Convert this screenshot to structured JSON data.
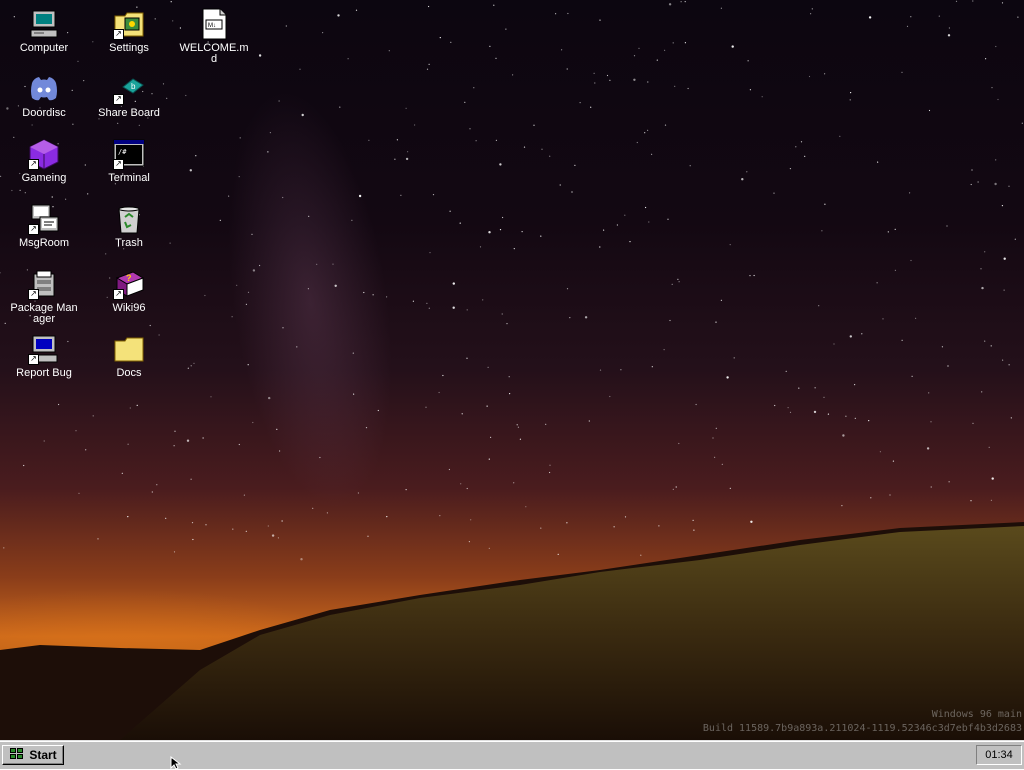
{
  "desktop": {
    "icons": [
      {
        "label": "Computer"
      },
      {
        "label": "Settings"
      },
      {
        "label": "WELCOME.md"
      },
      {
        "label": "Doordisc"
      },
      {
        "label": "Share Board"
      },
      {
        "label": "Gameing"
      },
      {
        "label": "Terminal"
      },
      {
        "label": "MsgRoom"
      },
      {
        "label": "Trash"
      },
      {
        "label": "Package Manager"
      },
      {
        "label": "Wiki96"
      },
      {
        "label": "Report Bug"
      },
      {
        "label": "Docs"
      }
    ],
    "watermark": {
      "line1": "Windows 96 main",
      "line2": "Build 11589.7b9a893a.211024-1119.52346c3d7ebf4b3d2683"
    }
  },
  "taskbar": {
    "start_label": "Start",
    "clock": "01:34"
  },
  "colors": {
    "taskbar_bg": "#c0c0c0",
    "folder_yellow": "#f4e27a",
    "discord_blue": "#7289da"
  }
}
